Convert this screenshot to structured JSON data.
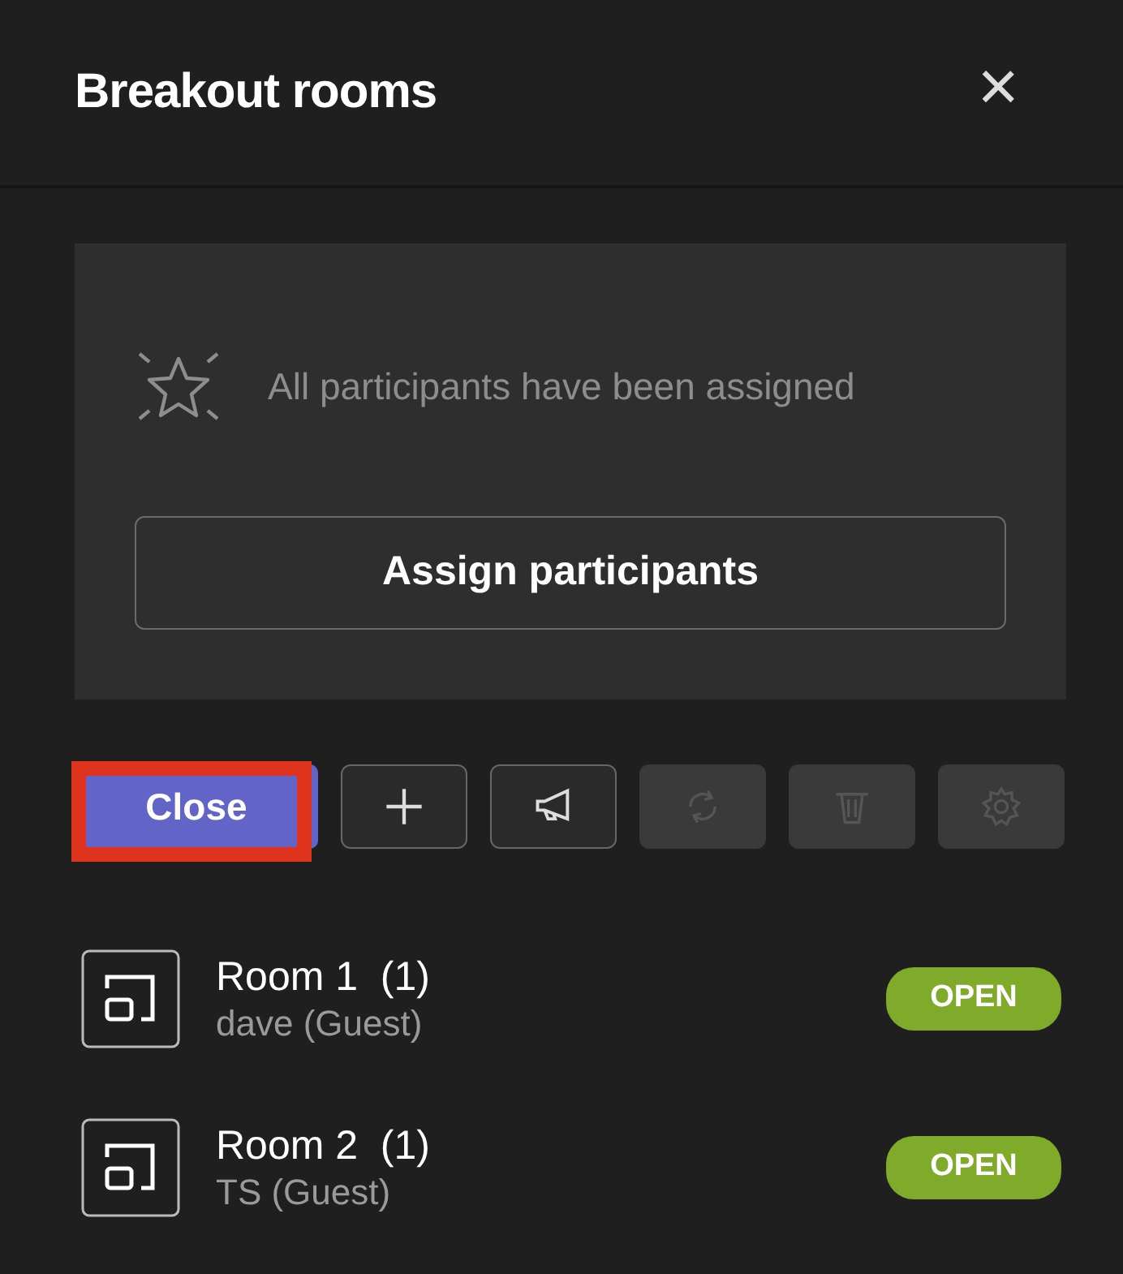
{
  "panel": {
    "title": "Breakout rooms",
    "close_icon": "×"
  },
  "assign_card": {
    "message": "All participants have been assigned",
    "button": "Assign participants"
  },
  "toolbar": [
    {
      "kind": "text",
      "label": "Close",
      "primary": true,
      "highlighted": true,
      "disabled": false
    },
    {
      "kind": "add",
      "disabled": false
    },
    {
      "kind": "megaphone",
      "disabled": false
    },
    {
      "kind": "recreate",
      "disabled": true
    },
    {
      "kind": "trash",
      "disabled": true
    },
    {
      "kind": "gear",
      "disabled": true
    }
  ],
  "rooms": [
    {
      "name": "Room 1  (1)",
      "members": "dave (Guest)",
      "status": "OPEN",
      "color": "#7faa2a"
    },
    {
      "name": "Room 2  (1)",
      "members": "TS (Guest)",
      "status": "OPEN",
      "color": "#7faa2a"
    }
  ]
}
